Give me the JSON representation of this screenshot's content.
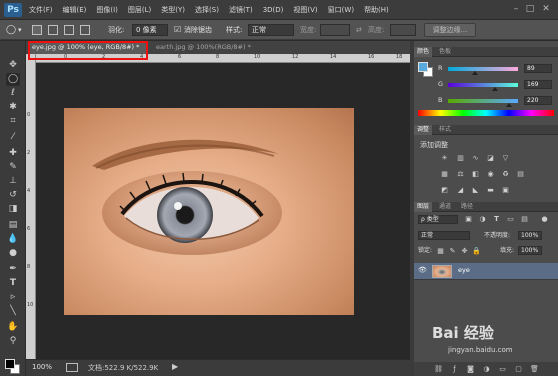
{
  "app": {
    "logo": "Ps"
  },
  "menu": [
    "文件(F)",
    "编辑(E)",
    "图像(I)",
    "图层(L)",
    "类型(Y)",
    "选择(S)",
    "滤镜(T)",
    "3D(D)",
    "视图(V)",
    "窗口(W)",
    "帮助(H)"
  ],
  "options": {
    "feather_label": "羽化:",
    "feather_value": "0 像素",
    "antialias_label": "消除锯齿",
    "style_label": "样式:",
    "style_value": "正常",
    "width_label": "宽度:",
    "height_label": "高度:",
    "refine_edge": "调整边缘..."
  },
  "tabs": [
    {
      "label": "eye.jpg @ 100% (eye, RGB/8#) *",
      "active": true
    },
    {
      "label": "earth.jpg @ 100%(RGB/8#) *",
      "active": false
    }
  ],
  "ruler_ticks": [
    "0",
    "2",
    "4",
    "6",
    "8",
    "10",
    "12",
    "14",
    "16",
    "18"
  ],
  "status": {
    "zoom": "100%",
    "doc": "文档:522.9 K/522.9K"
  },
  "color_panel": {
    "tabs": [
      "颜色",
      "色板"
    ],
    "channels": [
      {
        "label": "R",
        "value": "89"
      },
      {
        "label": "G",
        "value": "169"
      },
      {
        "label": "B",
        "value": "220"
      }
    ],
    "foreground": "#59a9dc"
  },
  "adjust_panel": {
    "tabs": [
      "调整",
      "样式"
    ],
    "title": "添加调整"
  },
  "layers_panel": {
    "tabs": [
      "图层",
      "通道",
      "路径"
    ],
    "kind_label": "ρ 类型",
    "blend_mode": "正常",
    "opacity_label": "不透明度:",
    "opacity_value": "100%",
    "lock_label": "锁定:",
    "fill_label": "填充:",
    "fill_value": "100%",
    "layers": [
      {
        "name": "eye"
      }
    ]
  },
  "watermark": {
    "brand": "Bai 经验",
    "sub": "jingyan.baidu.com"
  }
}
